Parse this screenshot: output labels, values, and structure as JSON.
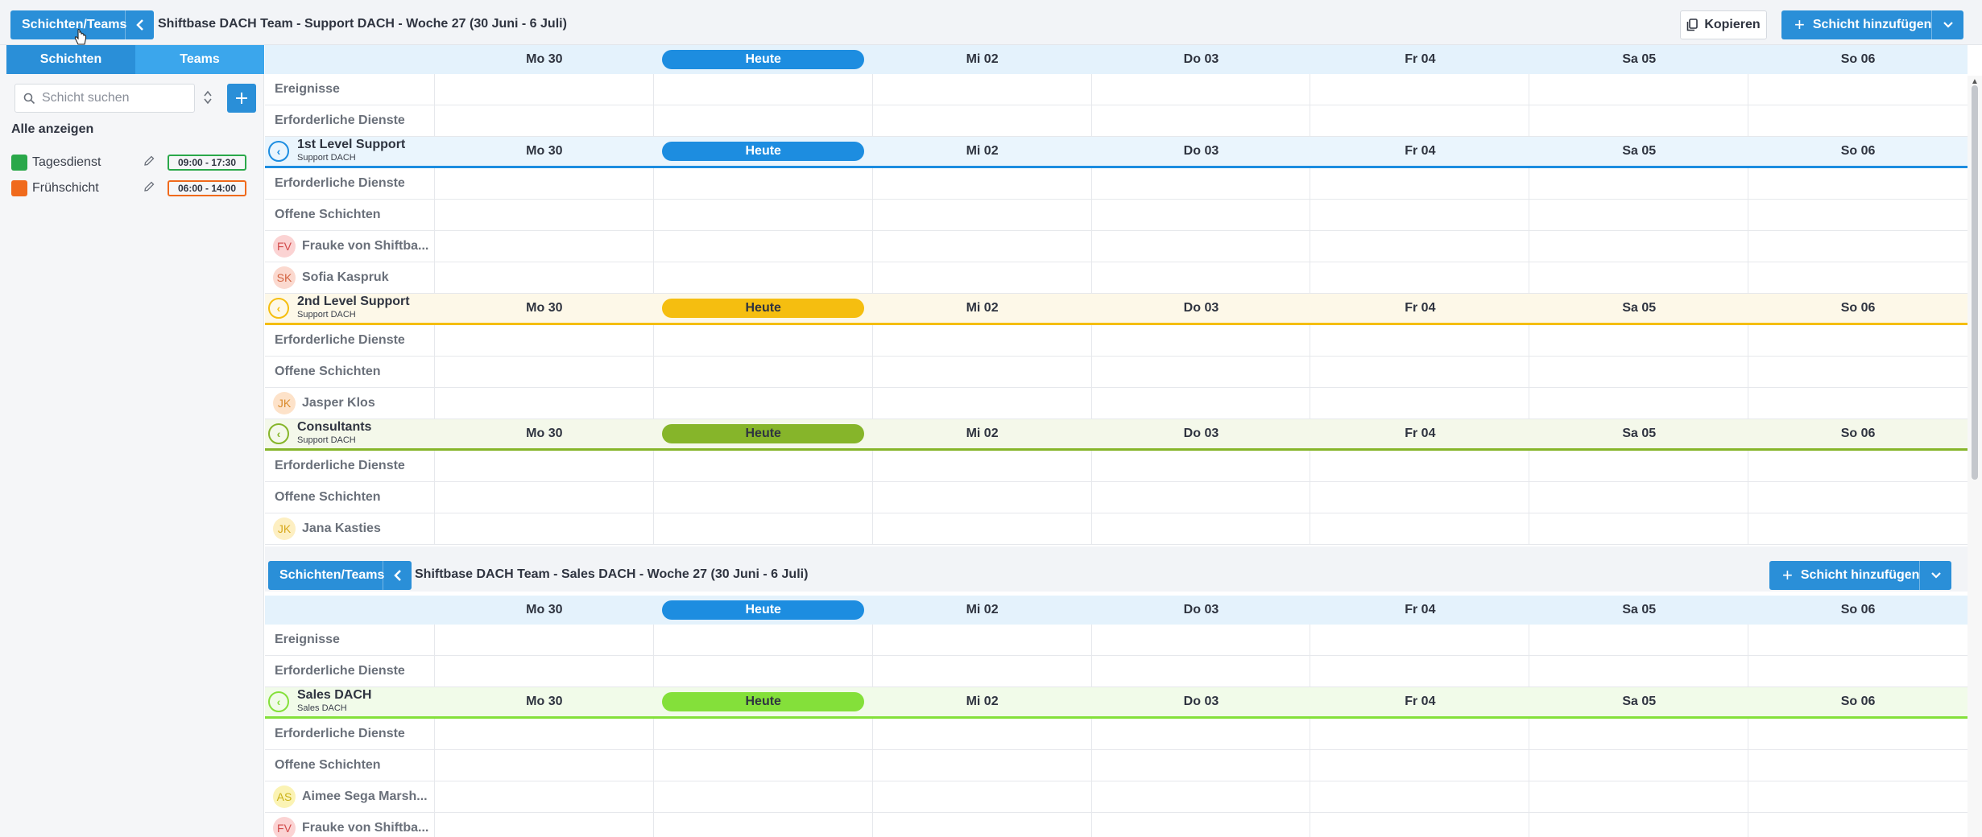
{
  "header1": {
    "breadcrumb": "Schichten/Teams",
    "title": "Shiftbase DACH Team - Support DACH - Woche 27 (30 Juni - 6 Juli)",
    "copy": "Kopieren",
    "add": "Schicht hinzufügen"
  },
  "header2": {
    "breadcrumb": "Schichten/Teams",
    "title": "Shiftbase DACH Team - Sales DACH - Woche 27 (30 Juni - 6 Juli)",
    "add": "Schicht hinzufügen"
  },
  "sidebar": {
    "tabs": [
      "Schichten",
      "Teams"
    ],
    "search_placeholder": "Schicht suchen",
    "show_all": "Alle anzeigen",
    "shifts": [
      {
        "name": "Tagesdienst",
        "time": "09:00 - 17:30",
        "color": "#2aa84a"
      },
      {
        "name": "Frühschicht",
        "time": "06:00 - 14:00",
        "color": "#f06a1c"
      }
    ]
  },
  "days": [
    "Mo 30",
    "Heute",
    "Mi 02",
    "Do 03",
    "Fr 04",
    "Sa 05",
    "So 06"
  ],
  "labels": {
    "events": "Ereignisse",
    "required": "Erforderliche Dienste",
    "open": "Offene Schichten"
  },
  "teams": [
    {
      "name": "1st Level Support",
      "sub": "Support DACH",
      "color": "#1d8de0",
      "bg": "#eaf5fd"
    },
    {
      "name": "2nd Level Support",
      "sub": "Support DACH",
      "color": "#f5be10",
      "bg": "#fdf8e8"
    },
    {
      "name": "Consultants",
      "sub": "Support DACH",
      "color": "#86b52a",
      "bg": "#f4f8ea"
    },
    {
      "name": "Sales DACH",
      "sub": "Sales DACH",
      "color": "#84e03a",
      "bg": "#f1fbe9"
    }
  ],
  "employees": {
    "fv": {
      "initials": "FV",
      "name": "Frauke von Shiftba...",
      "bg": "#fbd3d3",
      "fg": "#d24b4b"
    },
    "sk": {
      "initials": "SK",
      "name": "Sofia Kaspruk",
      "bg": "#fbd9cf",
      "fg": "#d2623f"
    },
    "jk1": {
      "initials": "JK",
      "name": "Jasper Klos",
      "bg": "#fde2c9",
      "fg": "#d98a2b"
    },
    "jk2": {
      "initials": "JK",
      "name": "Jana Kasties",
      "bg": "#fdefc2",
      "fg": "#d7a81c"
    },
    "as": {
      "initials": "AS",
      "name": "Aimee Sega Marsh...",
      "bg": "#fbf3b4",
      "fg": "#c9b116"
    }
  },
  "colors": {
    "primary": "#2a8fd8",
    "today_default": "#1d8de0",
    "day_header_bg": "#e4f2fc"
  }
}
